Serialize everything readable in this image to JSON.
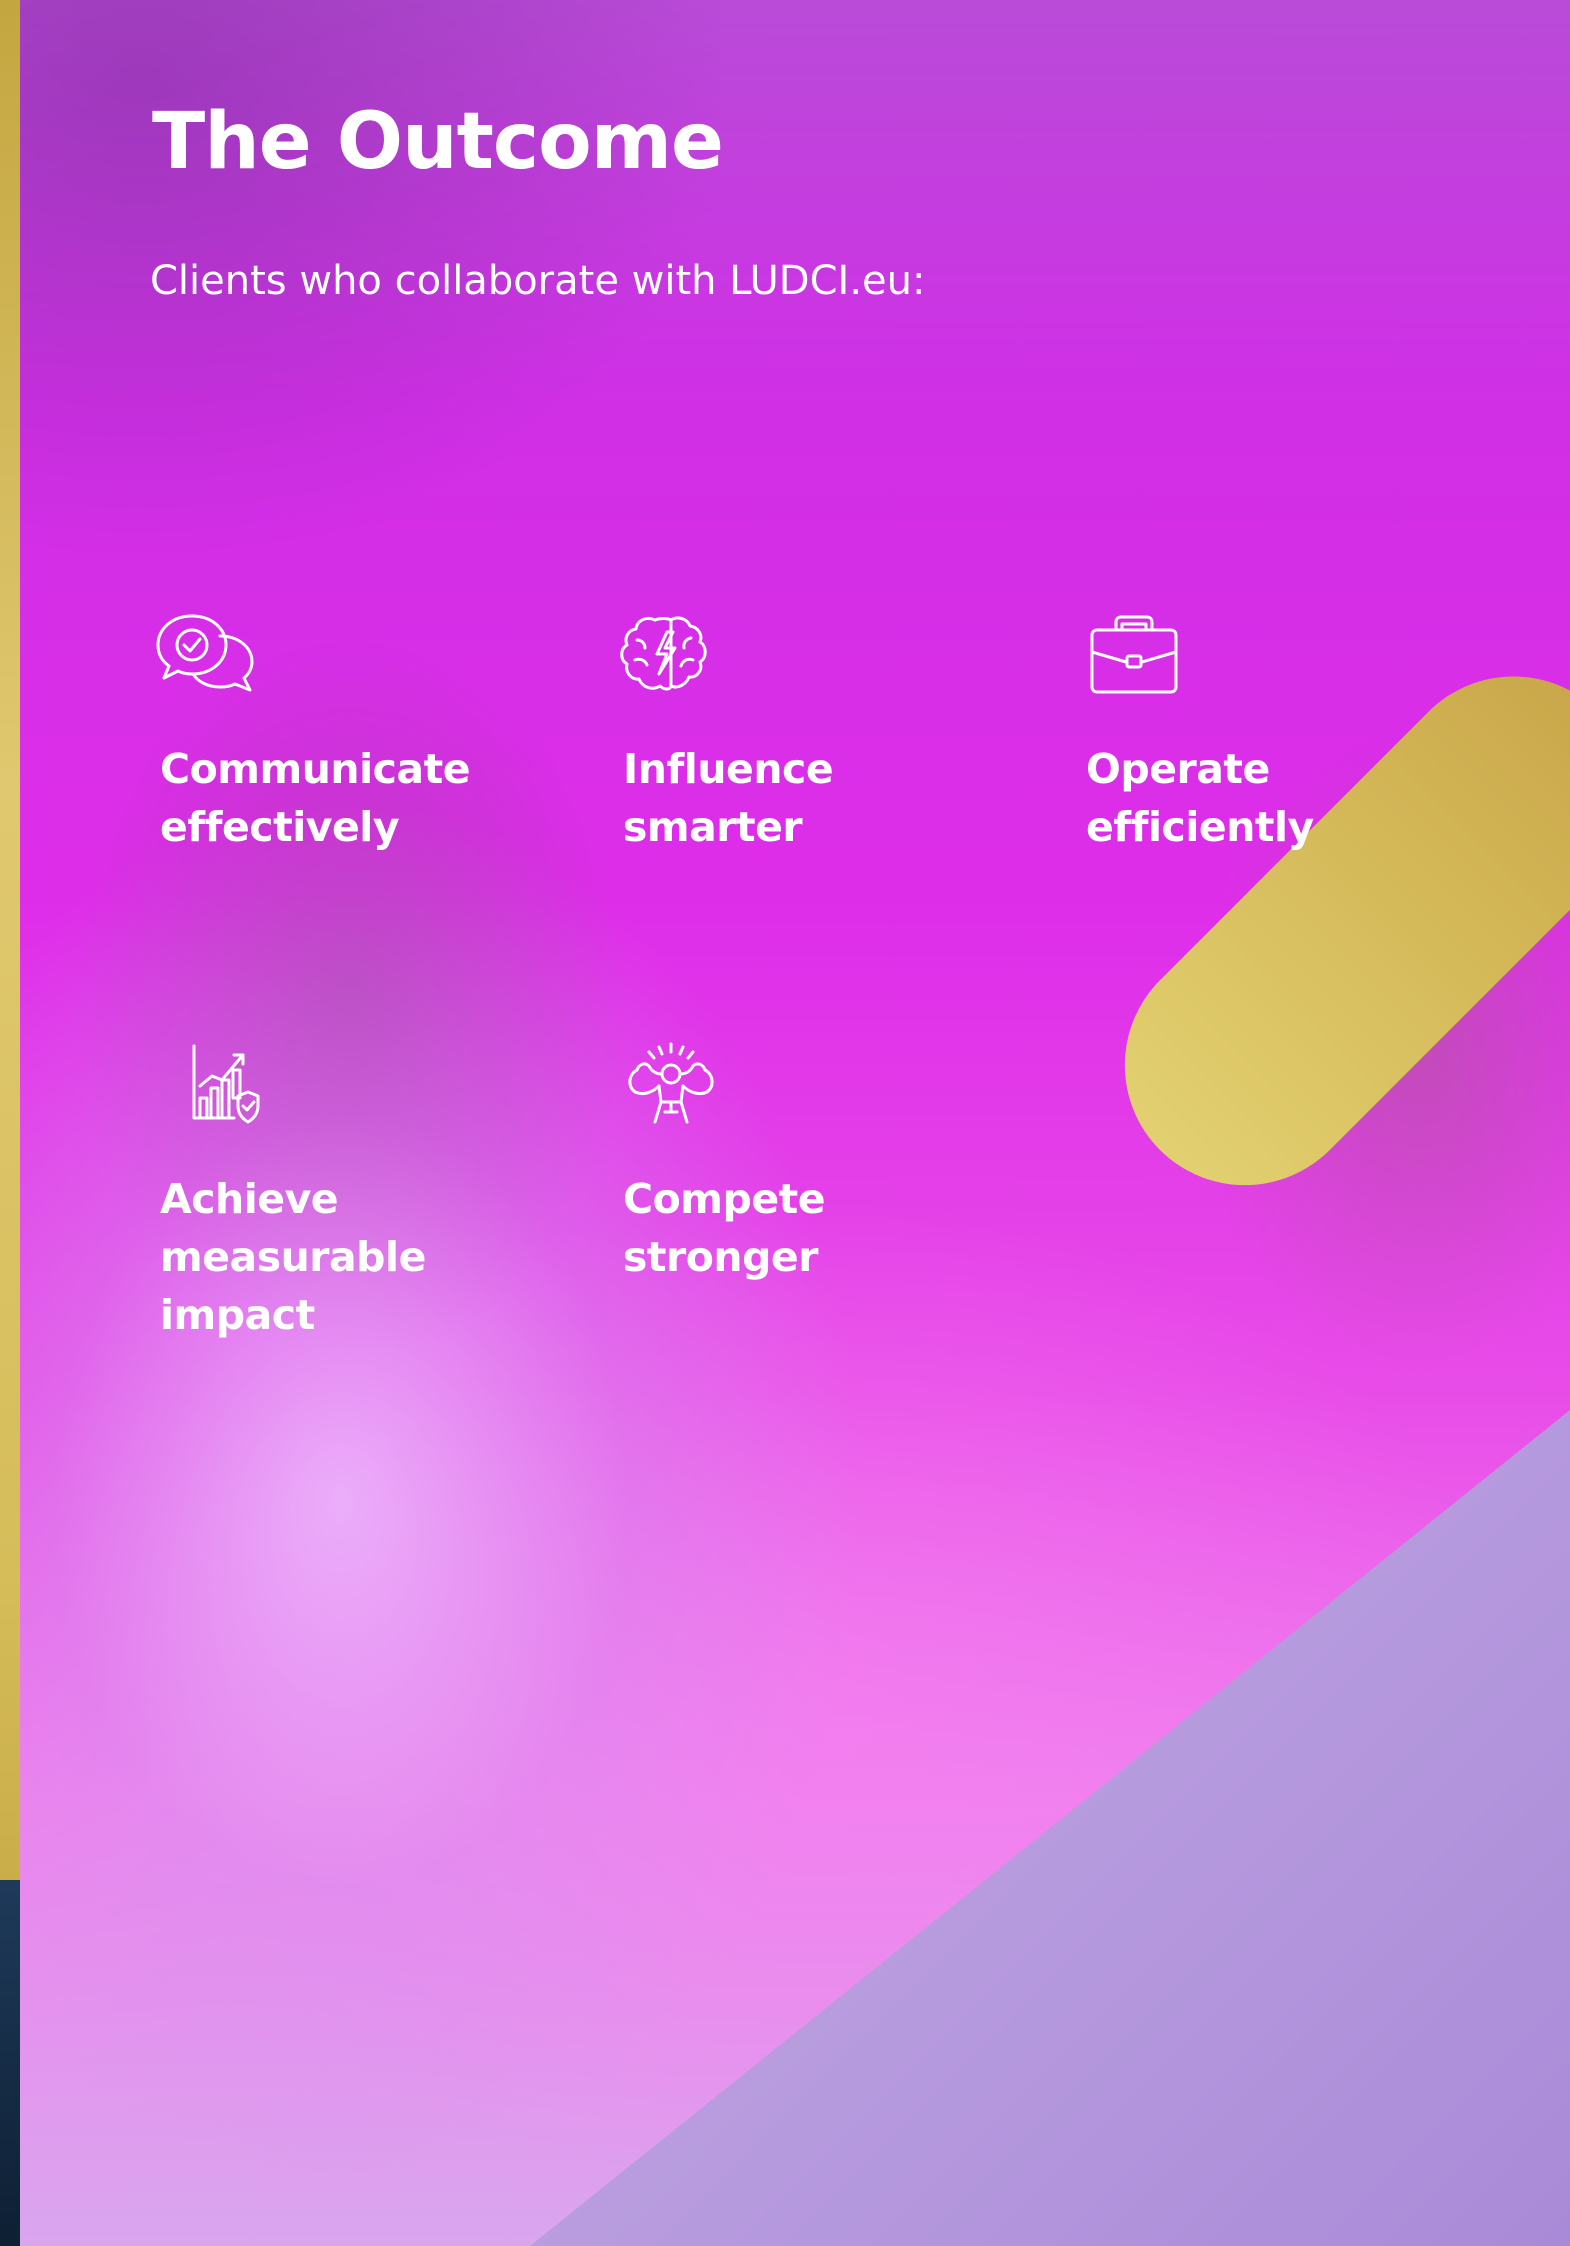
{
  "title": "The Outcome",
  "subtitle": "Clients who collaborate with LUDCI.eu:",
  "features": [
    {
      "icon": "chat-check-icon",
      "label": "Communicate effectively"
    },
    {
      "icon": "brain-lightning-icon",
      "label": "Influence smarter"
    },
    {
      "icon": "briefcase-icon",
      "label": "Operate efficiently"
    },
    {
      "icon": "growth-chart-shield-icon",
      "label": "Achieve measurable impact"
    },
    {
      "icon": "strong-person-icon",
      "label": "Compete stronger"
    }
  ],
  "colors": {
    "background_magenta": "#de2de9",
    "accent_gold": "#d4b858",
    "accent_lilac": "#c8b0e6",
    "text": "#ffffff"
  }
}
